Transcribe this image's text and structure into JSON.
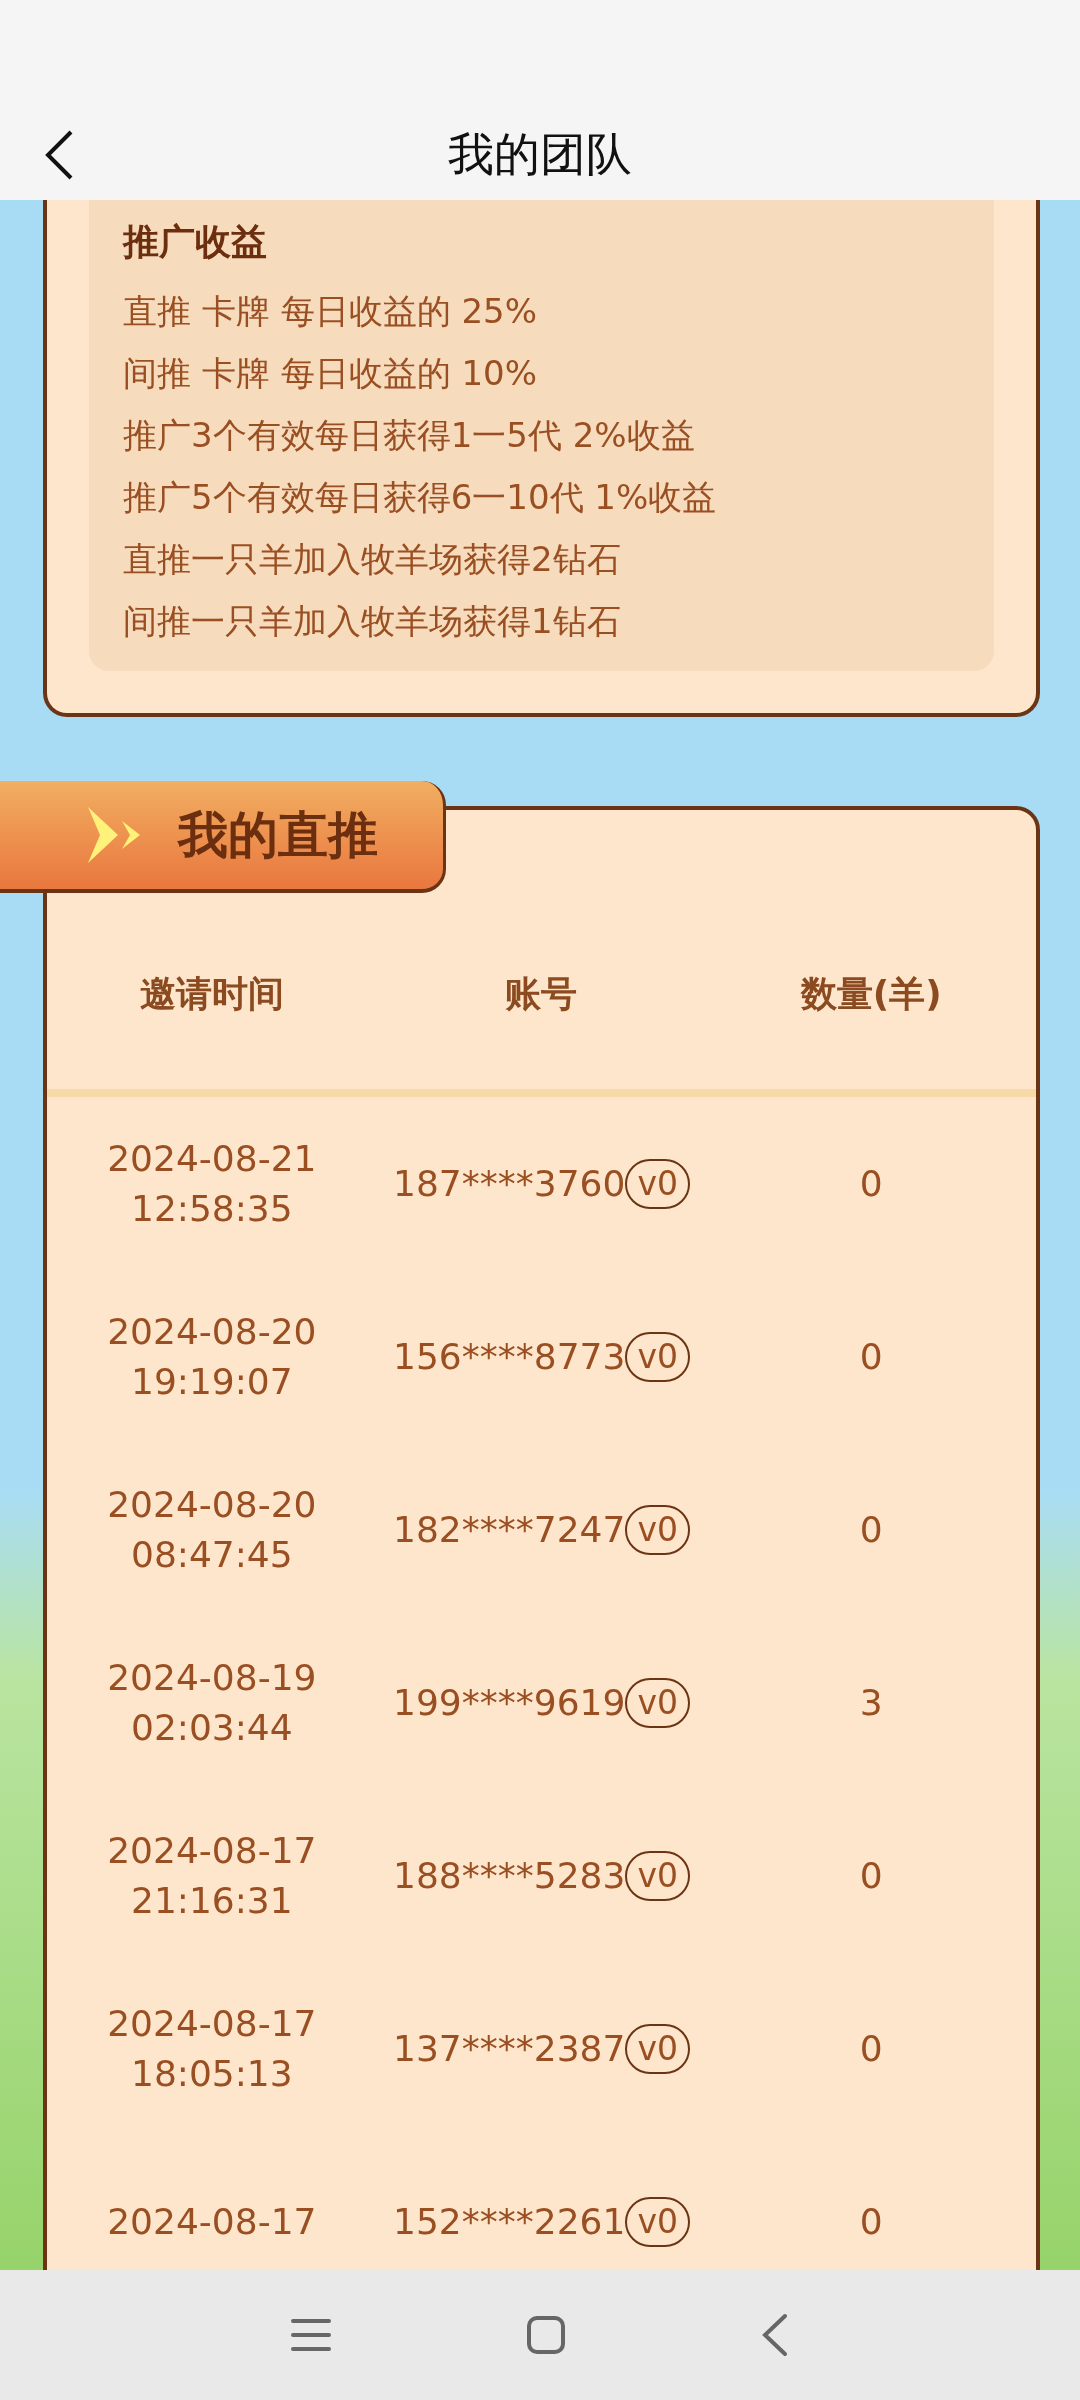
{
  "header": {
    "title": "我的团队"
  },
  "rules": {
    "title": "推广收益",
    "lines": [
      "直推 卡牌 每日收益的 25%",
      "间推 卡牌 每日收益的 10%",
      "推广3个有效每日获得1一5代 2%收益",
      "推广5个有效每日获得6一10代 1%收益",
      "直推一只羊加入牧羊场获得2钻石",
      "间推一只羊加入牧羊场获得1钻石"
    ]
  },
  "direct": {
    "tab": "我的直推",
    "columns": [
      "邀请时间",
      "账号",
      "数量(羊)"
    ],
    "rows": [
      {
        "date": "2024-08-21",
        "time": "12:58:35",
        "account": "187****3760",
        "level": "v0",
        "count": "0"
      },
      {
        "date": "2024-08-20",
        "time": "19:19:07",
        "account": "156****8773",
        "level": "v0",
        "count": "0"
      },
      {
        "date": "2024-08-20",
        "time": "08:47:45",
        "account": "182****7247",
        "level": "v0",
        "count": "0"
      },
      {
        "date": "2024-08-19",
        "time": "02:03:44",
        "account": "199****9619",
        "level": "v0",
        "count": "3"
      },
      {
        "date": "2024-08-17",
        "time": "21:16:31",
        "account": "188****5283",
        "level": "v0",
        "count": "0"
      },
      {
        "date": "2024-08-17",
        "time": "18:05:13",
        "account": "137****2387",
        "level": "v0",
        "count": "0"
      },
      {
        "date": "2024-08-17",
        "account": "152****2261",
        "level": "v0",
        "count": "0"
      }
    ]
  }
}
